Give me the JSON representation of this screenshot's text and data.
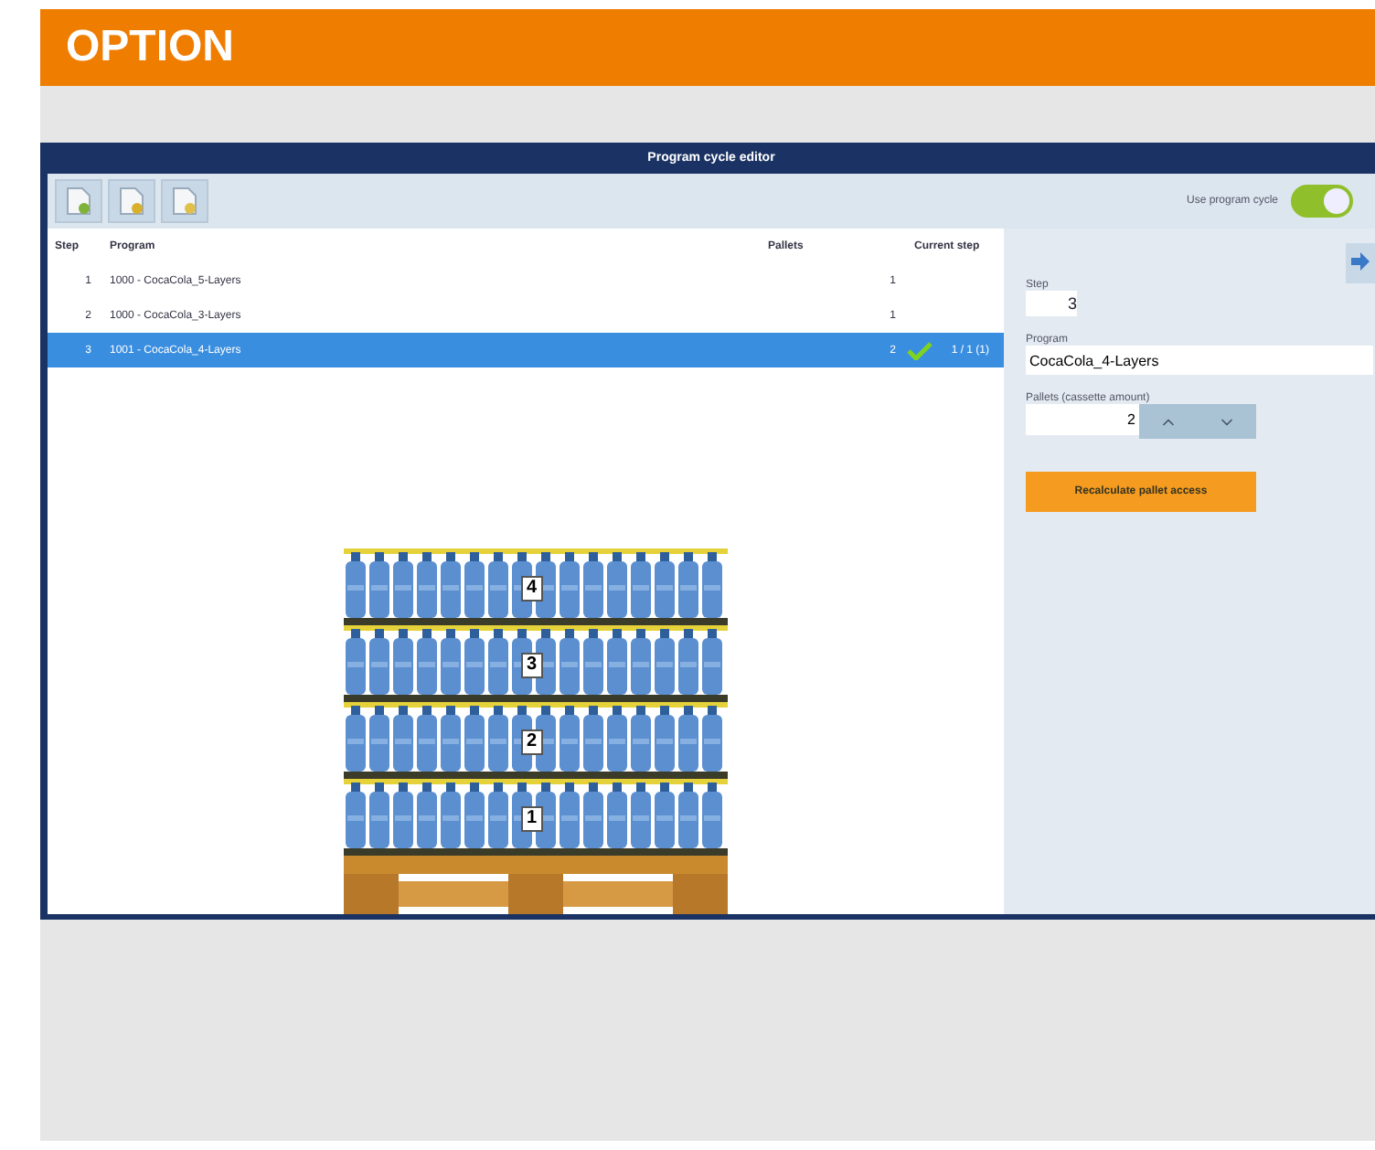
{
  "header": {
    "title": "OPTION"
  },
  "window": {
    "title": "Program cycle editor"
  },
  "toolbar": {
    "toggle": {
      "label": "Use program cycle",
      "on": true
    }
  },
  "table": {
    "columns": [
      "Step",
      "Program",
      "Pallets",
      "Current step"
    ],
    "rows": [
      {
        "step": "1",
        "program": "1000 - CocaCola_5-Layers",
        "pallets": "1",
        "current": false,
        "progress": "",
        "selected": false
      },
      {
        "step": "2",
        "program": "1000 - CocaCola_3-Layers",
        "pallets": "1",
        "current": false,
        "progress": "",
        "selected": false
      },
      {
        "step": "3",
        "program": "1001 - CocaCola_4-Layers",
        "pallets": "2",
        "current": true,
        "progress": "1 / 1 (1)",
        "selected": true
      }
    ]
  },
  "stack": {
    "layers": [
      "4",
      "3",
      "2",
      "1"
    ]
  },
  "panel": {
    "step_label": "Step",
    "step": "3",
    "program_label": "Program",
    "program": "CocaCola_4-Layers",
    "pallets_label": "Pallets (cassette amount)",
    "pallets": "2",
    "button": "Recalculate pallet access"
  }
}
